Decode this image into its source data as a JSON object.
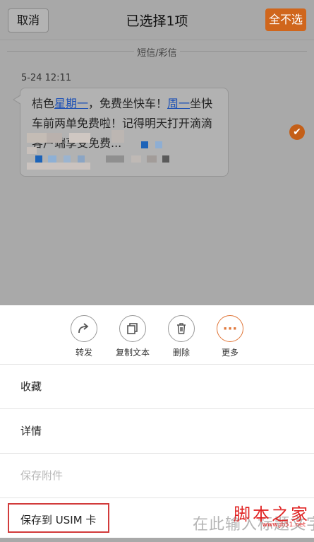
{
  "header": {
    "cancel_label": "取消",
    "title": "已选择1项",
    "select_all_label": "全不选",
    "accent_color": "#d0661c"
  },
  "conversation": {
    "section_label": "短信/彩信",
    "timestamp": "5-24 12:11",
    "message": {
      "part1": "桔色",
      "link1": "星期一",
      "part2": "，免费坐快车！",
      "link2": "周一",
      "part3": "坐快车前两单免费啦！记得明天打开滴滴客户端享受免费..."
    },
    "selected": true
  },
  "action_bar": {
    "items": [
      {
        "icon": "forward-icon",
        "label": "转发"
      },
      {
        "icon": "copy-icon",
        "label": "复制文本"
      },
      {
        "icon": "trash-icon",
        "label": "删除"
      },
      {
        "icon": "more-icon",
        "label": "更多"
      }
    ]
  },
  "menu": {
    "items": [
      {
        "label": "收藏",
        "enabled": true
      },
      {
        "label": "详情",
        "enabled": true
      },
      {
        "label": "保存附件",
        "enabled": false
      },
      {
        "label": "保存到 USIM 卡",
        "enabled": true
      }
    ]
  },
  "watermark": {
    "logo": "脚本之家",
    "site": "www.jb51.net",
    "text": "在此输入标题文字"
  }
}
